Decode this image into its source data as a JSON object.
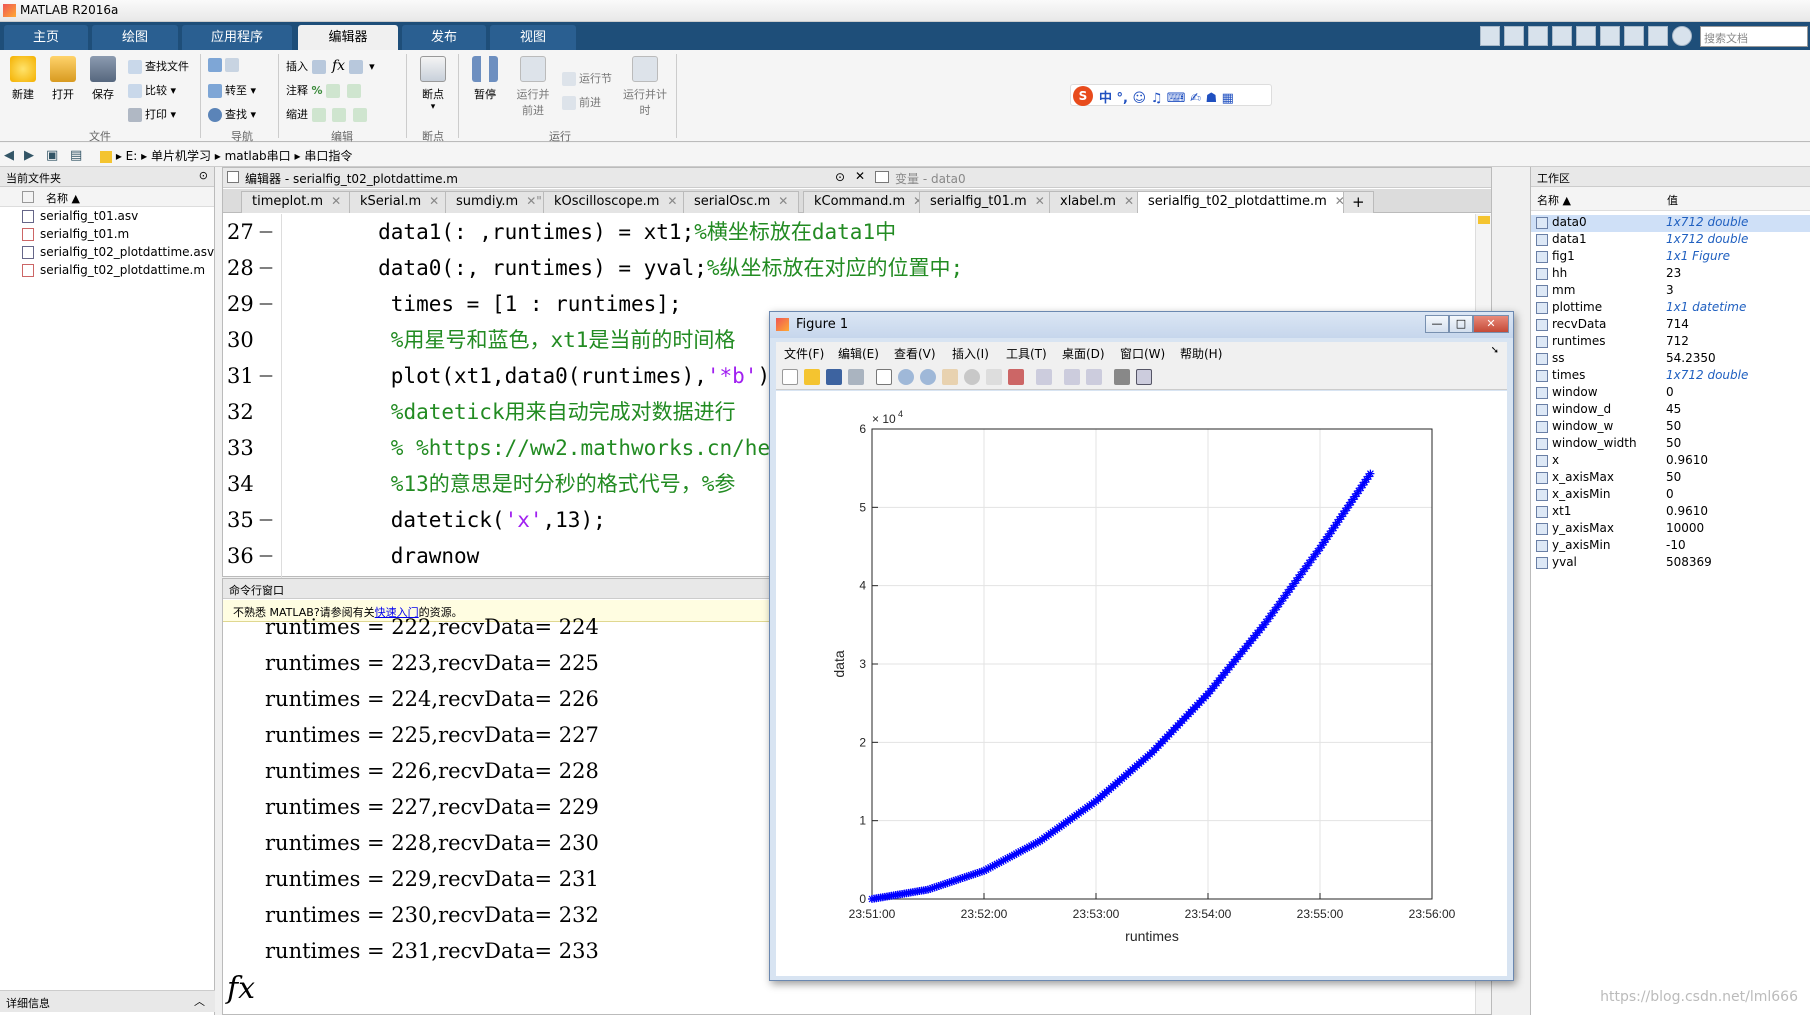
{
  "app": {
    "title": "MATLAB R2016a"
  },
  "ribbon": {
    "tabs": [
      "主页",
      "绘图",
      "应用程序",
      "编辑器",
      "发布",
      "视图"
    ],
    "active_tab": "编辑器",
    "search_placeholder": "搜索文档",
    "file_group": {
      "new": "新建",
      "open": "打开",
      "save": "保存",
      "find_files": "查找文件",
      "compare": "比较",
      "print": "打印",
      "label": "文件"
    },
    "nav_group": {
      "goto": "转至",
      "find": "查找",
      "label": "导航"
    },
    "edit_group": {
      "insert": "插入",
      "comment": "注释",
      "indent": "缩进",
      "label": "编辑"
    },
    "breakpoint_group": {
      "breakpoints": "断点",
      "label": "断点"
    },
    "run_group": {
      "pause": "暂停",
      "run_advance": "运行并前进",
      "run_section": "运行节",
      "advance": "前进",
      "run_time": "运行并计时",
      "label": "运行"
    }
  },
  "ime": {
    "logo": "S",
    "glyphs": "中 °, ☺ ♫ ⌨ ✍ ☗ ▦"
  },
  "address": {
    "drive": "E:",
    "path": [
      "单片机学习",
      "matlab串口",
      "串口指令"
    ]
  },
  "current_folder": {
    "title": "当前文件夹",
    "col_name": "名称 ▲",
    "files": [
      "serialfig_t01.asv",
      "serialfig_t01.m",
      "serialfig_t02_plotdattime.asv",
      "serialfig_t02_plotdattime.m"
    ],
    "details_label": "详细信息"
  },
  "editor": {
    "header": "编辑器 - serialfig_t02_plotdattime.m",
    "variables_header": "变量 - data0",
    "tabs": [
      "timeplot.m",
      "kSerial.m",
      "sumdiy.m",
      "kOscilloscope.m",
      "serialOsc.m",
      "kCommand.m",
      "serialfig_t01.m",
      "xlabel.m",
      "serialfig_t02_plotdattime.m"
    ],
    "active_tab": "serialfig_t02_plotdattime.m",
    "add_tab": "+",
    "lines": [
      {
        "num": "27",
        "dash": "—",
        "code": "        data1(: ,runtimes) = xt1;",
        "comment": "%横坐标放在data1中"
      },
      {
        "num": "28",
        "dash": "—",
        "code": "        data0(:, runtimes) = yval;",
        "comment": "%纵坐标放在对应的位置中;"
      },
      {
        "num": "29",
        "dash": "—",
        "code": "         times = [1 : runtimes];",
        "comment": ""
      },
      {
        "num": "30",
        "dash": "",
        "code": "         ",
        "comment": "%用星号和蓝色，xt1是当前的时间格"
      },
      {
        "num": "31",
        "dash": "—",
        "code": "         plot(xt1,data0(runtimes),",
        "string": "'*b'",
        "tail": ");"
      },
      {
        "num": "32",
        "dash": "",
        "code": "         ",
        "comment": "%datetick用来自动完成对数据进行"
      },
      {
        "num": "33",
        "dash": "",
        "code": "         ",
        "comment": "% %https://ww2.mathworks.cn/hel"
      },
      {
        "num": "34",
        "dash": "",
        "code": "         ",
        "comment": "%13的意思是时分秒的格式代号，%参"
      },
      {
        "num": "35",
        "dash": "—",
        "code": "         datetick(",
        "string": "'x'",
        "tail": ",13);"
      },
      {
        "num": "36",
        "dash": "—",
        "code": "         drawnow",
        "comment": ""
      }
    ]
  },
  "command_window": {
    "title": "命令行窗口",
    "tip_prefix": "不熟悉 MATLAB?请参阅有关",
    "tip_link": "快速入门",
    "tip_suffix": "的资源。",
    "lines": [
      "runtimes = 222,recvData= 224",
      "runtimes = 223,recvData= 225",
      "runtimes = 224,recvData= 226",
      "runtimes = 225,recvData= 227",
      "runtimes = 226,recvData= 228",
      "runtimes = 227,recvData= 229",
      "runtimes = 228,recvData= 230",
      "runtimes = 229,recvData= 231",
      "runtimes = 230,recvData= 232",
      "runtimes = 231,recvData= 233"
    ],
    "prompt": "fx"
  },
  "workspace": {
    "title": "工作区",
    "col_name": "名称 ▲",
    "col_value": "值",
    "vars": [
      {
        "name": "data0",
        "value": "1x712 double",
        "italic": true,
        "selected": true
      },
      {
        "name": "data1",
        "value": "1x712 double",
        "italic": true
      },
      {
        "name": "fig1",
        "value": "1x1 Figure",
        "italic": true
      },
      {
        "name": "hh",
        "value": "23"
      },
      {
        "name": "mm",
        "value": "3"
      },
      {
        "name": "plottime",
        "value": "1x1 datetime",
        "italic": true
      },
      {
        "name": "recvData",
        "value": "714"
      },
      {
        "name": "runtimes",
        "value": "712"
      },
      {
        "name": "ss",
        "value": "54.2350"
      },
      {
        "name": "times",
        "value": "1x712 double",
        "italic": true
      },
      {
        "name": "window",
        "value": "0"
      },
      {
        "name": "window_d",
        "value": "45"
      },
      {
        "name": "window_w",
        "value": "50"
      },
      {
        "name": "window_width",
        "value": "50"
      },
      {
        "name": "x",
        "value": "0.9610"
      },
      {
        "name": "x_axisMax",
        "value": "50"
      },
      {
        "name": "x_axisMin",
        "value": "0"
      },
      {
        "name": "xt1",
        "value": "0.9610"
      },
      {
        "name": "y_axisMax",
        "value": "10000"
      },
      {
        "name": "y_axisMin",
        "value": "-10"
      },
      {
        "name": "yval",
        "value": "508369"
      }
    ]
  },
  "figure": {
    "title": "Figure 1",
    "menus": [
      "文件(F)",
      "编辑(E)",
      "查看(V)",
      "插入(I)",
      "工具(T)",
      "桌面(D)",
      "窗口(W)",
      "帮助(H)"
    ],
    "win_buttons": [
      "—",
      "□",
      "✕"
    ]
  },
  "chart_data": {
    "type": "scatter",
    "marker": "*",
    "color": "#0000ff",
    "title": "",
    "xlabel": "runtimes",
    "ylabel": "data",
    "y_exponent_label": "× 10",
    "y_exponent": "4",
    "grid": true,
    "xlim": [
      "23:51:00",
      "23:56:00"
    ],
    "ylim": [
      0,
      6
    ],
    "xticks": [
      "23:51:00",
      "23:52:00",
      "23:53:00",
      "23:54:00",
      "23:55:00",
      "23:56:00"
    ],
    "yticks": [
      "0",
      "1",
      "2",
      "3",
      "4",
      "5",
      "6"
    ],
    "series": [
      {
        "x": [
          "23:51:00",
          "23:51:30",
          "23:52:00",
          "23:52:30",
          "23:53:00",
          "23:53:30",
          "23:54:00",
          "23:54:30",
          "23:55:00",
          "23:55:27"
        ],
        "y": [
          0.0,
          0.12,
          0.36,
          0.74,
          1.25,
          1.87,
          2.62,
          3.5,
          4.48,
          5.43
        ]
      }
    ]
  },
  "watermark": "https://blog.csdn.net/lml666"
}
